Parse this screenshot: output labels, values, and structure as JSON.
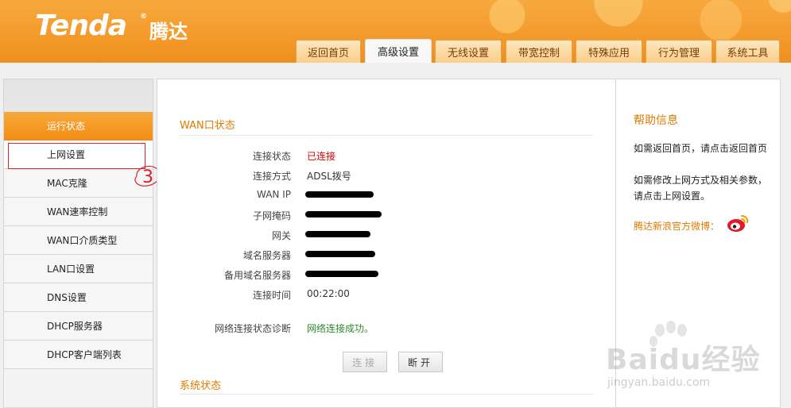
{
  "brand": {
    "logo_text": "Tenda",
    "logo_cn": "腾达",
    "registered": "®"
  },
  "tabs": [
    {
      "label": "返回首页",
      "active": false
    },
    {
      "label": "高级设置",
      "active": true
    },
    {
      "label": "无线设置",
      "active": false
    },
    {
      "label": "带宽控制",
      "active": false
    },
    {
      "label": "特殊应用",
      "active": false
    },
    {
      "label": "行为管理",
      "active": false
    },
    {
      "label": "系统工具",
      "active": false
    }
  ],
  "sidebar": {
    "items": [
      {
        "label": "运行状态",
        "active": true
      },
      {
        "label": "上网设置",
        "active": false
      },
      {
        "label": "MAC克隆",
        "active": false
      },
      {
        "label": "WAN速率控制",
        "active": false
      },
      {
        "label": "WAN口介质类型",
        "active": false
      },
      {
        "label": "LAN口设置",
        "active": false
      },
      {
        "label": "DNS设置",
        "active": false
      },
      {
        "label": "DHCP服务器",
        "active": false
      },
      {
        "label": "DHCP客户端列表",
        "active": false
      }
    ],
    "annotation": "3"
  },
  "wan": {
    "title": "WAN口状态",
    "rows": [
      {
        "label": "连接状态",
        "value": "已连接",
        "style": "red"
      },
      {
        "label": "连接方式",
        "value": "ADSL拨号",
        "style": "normal"
      },
      {
        "label": "WAN IP",
        "value": "",
        "style": "redacted"
      },
      {
        "label": "子网掩码",
        "value": "",
        "style": "redacted"
      },
      {
        "label": "网关",
        "value": "",
        "style": "redacted"
      },
      {
        "label": "域名服务器",
        "value": "",
        "style": "redacted"
      },
      {
        "label": "备用域名服务器",
        "value": "",
        "style": "redacted"
      },
      {
        "label": "连接时间",
        "value": "00:22:00",
        "style": "normal"
      }
    ],
    "diag_label": "网络连接状态诊断",
    "diag_value": "网络连接成功。",
    "connect_button": "连接",
    "disconnect_button": "断开"
  },
  "system": {
    "title": "系统状态"
  },
  "help": {
    "title": "帮助信息",
    "text1": "如需返回首页，请点击返回首页",
    "text2": "如需修改上网方式及相关参数，请点击上网设置。",
    "weibo_label": "腾达新浪官方微博："
  },
  "watermark": {
    "main": "Baidu经验",
    "sub": "jingyan.baidu.com"
  },
  "colors": {
    "header": "#f39a2a",
    "accent": "#e07a00",
    "active_side": "#f38d15",
    "status_red": "#d40000",
    "status_green": "#2e8b2e"
  }
}
